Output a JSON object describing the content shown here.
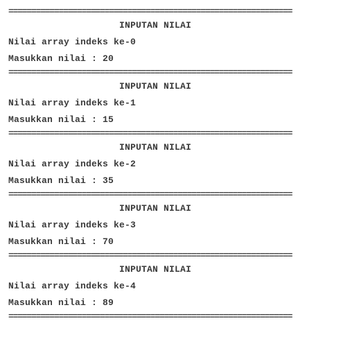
{
  "separator": "==============================================================",
  "blocks": [
    {
      "title": "INPUTAN NILAI",
      "index_line": "Nilai array indeks ke-0",
      "input_line": "Masukkan nilai : 20"
    },
    {
      "title": "INPUTAN NILAI",
      "index_line": "Nilai array indeks ke-1",
      "input_line": "Masukkan nilai : 15"
    },
    {
      "title": "INPUTAN NILAI",
      "index_line": "Nilai array indeks ke-2",
      "input_line": "Masukkan nilai : 35"
    },
    {
      "title": "INPUTAN NILAI",
      "index_line": "Nilai array indeks ke-3",
      "input_line": "Masukkan nilai : 70"
    },
    {
      "title": "INPUTAN NILAI",
      "index_line": "Nilai array indeks ke-4",
      "input_line": "Masukkan nilai : 89"
    }
  ]
}
